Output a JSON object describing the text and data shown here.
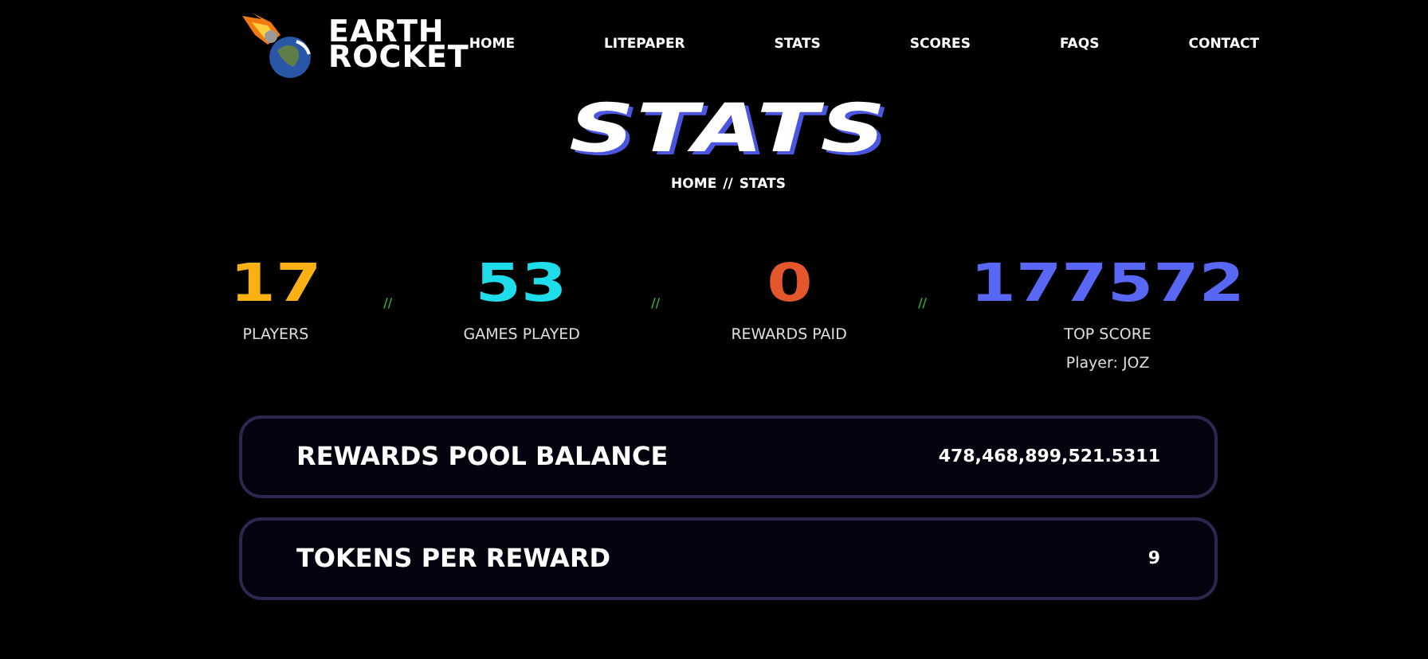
{
  "logo": {
    "line_1": "EARTH",
    "line_2": "ROCKET"
  },
  "nav": [
    {
      "label": "HOME"
    },
    {
      "label": "LITEPAPER"
    },
    {
      "label": "STATS"
    },
    {
      "label": "SCORES"
    },
    {
      "label": "FAQS"
    },
    {
      "label": "CONTACT"
    }
  ],
  "page_title": "STATS",
  "breadcrumb": {
    "home": "HOME",
    "separator": "//",
    "current": "STATS"
  },
  "stats": [
    {
      "value": "17",
      "label": "PLAYERS",
      "color": "#fbb116"
    },
    {
      "value": "53",
      "label": "GAMES PLAYED",
      "color": "#1fdcea"
    },
    {
      "value": "0",
      "label": "REWARDS PAID",
      "color": "#e4562b"
    },
    {
      "value": "177572",
      "label": "TOP SCORE",
      "color": "#5868f5",
      "note": "Player: JOZ"
    }
  ],
  "stat_separator": "//",
  "info_cards": [
    {
      "label": "REWARDS POOL BALANCE",
      "value": "478,468,899,521.5311"
    },
    {
      "label": "TOKENS PER REWARD",
      "value": "9"
    }
  ]
}
